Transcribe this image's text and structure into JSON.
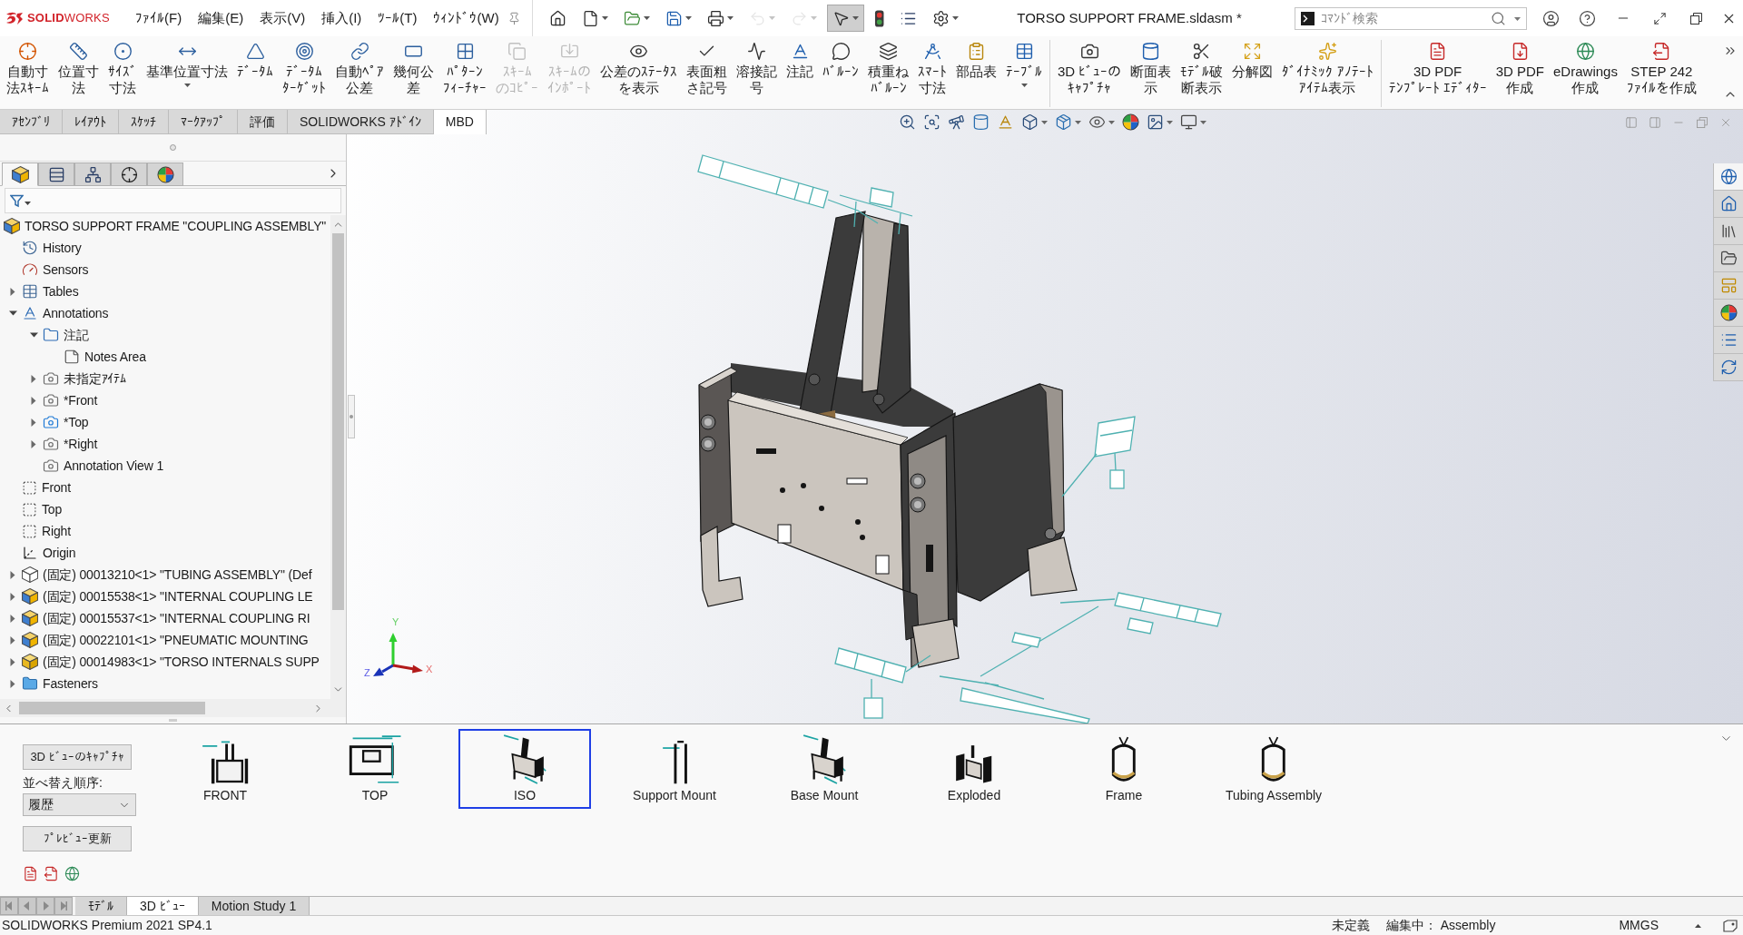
{
  "app": {
    "logo": "**SOLID**WORKS"
  },
  "menu": [
    "ﾌｧｲﾙ(F)",
    "編集(E)",
    "表示(V)",
    "挿入(I)",
    "ﾂｰﾙ(T)",
    "ｳｨﾝﾄﾞｳ(W)"
  ],
  "quick_access": [
    {
      "dropdown": false,
      "disabled": false,
      "pressed": false
    },
    {
      "dropdown": true,
      "disabled": false,
      "pressed": false
    },
    {
      "dropdown": true,
      "disabled": false,
      "pressed": false
    },
    {
      "dropdown": true,
      "disabled": false,
      "pressed": false
    },
    {
      "dropdown": true,
      "disabled": false,
      "pressed": false
    },
    {
      "dropdown": true,
      "disabled": true,
      "pressed": false
    },
    {
      "dropdown": true,
      "disabled": true,
      "pressed": false
    },
    {
      "dropdown": true,
      "disabled": false,
      "pressed": true
    },
    {
      "dropdown": false,
      "disabled": false,
      "pressed": false
    },
    {
      "dropdown": false,
      "disabled": false,
      "pressed": false
    },
    {
      "dropdown": true,
      "disabled": false,
      "pressed": false
    }
  ],
  "window": {
    "title": "TORSO SUPPORT FRAME.sldasm *"
  },
  "search": {
    "placeholder": "ｺﾏﾝﾄﾞ検索"
  },
  "ribbon_groups": [
    {
      "items": [
        {
          "lines": [
            "自動寸",
            "法ｽｷｰﾑ"
          ],
          "disabled": false,
          "dropdown": false
        },
        {
          "lines": [
            "位置寸",
            "法"
          ],
          "disabled": false,
          "dropdown": false
        },
        {
          "lines": [
            "ｻｲｽﾞ",
            "寸法"
          ],
          "disabled": false,
          "dropdown": false
        },
        {
          "lines": [
            "基準位置寸法"
          ],
          "disabled": false,
          "dropdown": true
        },
        {
          "lines": [
            "ﾃﾞｰﾀﾑ"
          ],
          "disabled": false,
          "dropdown": false
        },
        {
          "lines": [
            "ﾃﾞｰﾀﾑ",
            "ﾀｰｹﾞｯﾄ"
          ],
          "disabled": false,
          "dropdown": false
        },
        {
          "lines": [
            "自動ﾍﾟｱ",
            "公差"
          ],
          "disabled": false,
          "dropdown": false
        },
        {
          "lines": [
            "幾何公",
            "差"
          ],
          "disabled": false,
          "dropdown": false
        },
        {
          "lines": [
            "ﾊﾟﾀｰﾝ",
            "ﾌｨｰﾁｬｰ"
          ],
          "disabled": false,
          "dropdown": false
        },
        {
          "lines": [
            "ｽｷｰﾑ",
            "のｺﾋﾟｰ"
          ],
          "disabled": true,
          "dropdown": false
        },
        {
          "lines": [
            "ｽｷｰﾑの",
            "ｲﾝﾎﾟｰﾄ"
          ],
          "disabled": true,
          "dropdown": false
        },
        {
          "lines": [
            "公差のｽﾃｰﾀｽ",
            "を表示"
          ],
          "disabled": false,
          "dropdown": false
        },
        {
          "lines": [
            "表面粗",
            "さ記号"
          ],
          "disabled": false,
          "dropdown": false
        },
        {
          "lines": [
            "溶接記",
            "号"
          ],
          "disabled": false,
          "dropdown": false
        },
        {
          "lines": [
            "注記"
          ],
          "disabled": false,
          "dropdown": false
        },
        {
          "lines": [
            "ﾊﾞﾙｰﾝ"
          ],
          "disabled": false,
          "dropdown": false
        },
        {
          "lines": [
            "積重ね",
            "ﾊﾞﾙｰﾝ"
          ],
          "disabled": false,
          "dropdown": false
        },
        {
          "lines": [
            "ｽﾏｰﾄ",
            "寸法"
          ],
          "disabled": false,
          "dropdown": false
        },
        {
          "lines": [
            "部品表"
          ],
          "disabled": false,
          "dropdown": false
        },
        {
          "lines": [
            "ﾃｰﾌﾞﾙ"
          ],
          "disabled": false,
          "dropdown": true
        }
      ]
    },
    {
      "items": [
        {
          "lines": [
            "3D ﾋﾞｭｰの",
            "ｷｬﾌﾟﾁｬ"
          ],
          "disabled": false,
          "dropdown": false
        },
        {
          "lines": [
            "断面表",
            "示"
          ],
          "disabled": false,
          "dropdown": false
        },
        {
          "lines": [
            "ﾓﾃﾞﾙ破",
            "断表示"
          ],
          "disabled": false,
          "dropdown": false
        },
        {
          "lines": [
            "分解図"
          ],
          "disabled": false,
          "dropdown": false
        },
        {
          "lines": [
            "ﾀﾞｲﾅﾐｯｸ ｱﾉﾃｰﾄ",
            "ｱｲﾃﾑ表示"
          ],
          "disabled": false,
          "dropdown": false
        }
      ]
    },
    {
      "items": [
        {
          "lines": [
            "3D PDF",
            "ﾃﾝﾌﾟﾚｰﾄ ｴﾃﾞｨﾀｰ"
          ],
          "disabled": false,
          "dropdown": false
        },
        {
          "lines": [
            "3D PDF",
            "作成"
          ],
          "disabled": false,
          "dropdown": false
        },
        {
          "lines": [
            "eDrawings",
            "作成"
          ],
          "disabled": false,
          "dropdown": false
        },
        {
          "lines": [
            "STEP 242",
            "ﾌｧｲﾙを作成"
          ],
          "disabled": false,
          "dropdown": false
        }
      ]
    }
  ],
  "command_tabs": [
    {
      "label": "ｱｾﾝﾌﾞﾘ",
      "selected": false
    },
    {
      "label": "ﾚｲｱｳﾄ",
      "selected": false
    },
    {
      "label": "ｽｹｯﾁ",
      "selected": false
    },
    {
      "label": "ﾏｰｸｱｯﾌﾟ",
      "selected": false
    },
    {
      "label": "評価",
      "selected": false
    },
    {
      "label": "SOLIDWORKS ｱﾄﾞｲﾝ",
      "selected": false
    },
    {
      "label": "MBD",
      "selected": true
    }
  ],
  "view_toolbar": [
    {
      "dropdown": false
    },
    {
      "dropdown": false
    },
    {
      "dropdown": false
    },
    {
      "dropdown": false
    },
    {
      "dropdown": false
    },
    {
      "dropdown": true
    },
    {
      "dropdown": true
    },
    {
      "dropdown": true
    },
    {
      "dropdown": false
    },
    {
      "dropdown": true
    },
    {
      "dropdown": true
    }
  ],
  "feature_manager": {
    "tabs": [
      {
        "selected": true
      },
      {
        "selected": false
      },
      {
        "selected": false
      },
      {
        "selected": false
      },
      {
        "selected": false
      }
    ],
    "tree": {
      "label": "TORSO SUPPORT FRAME \"COUPLING ASSEMBLY\"",
      "kind": "root",
      "children": [
        {
          "label": "History",
          "kind": "history"
        },
        {
          "label": "Sensors",
          "kind": "sensors"
        },
        {
          "label": "Tables",
          "kind": "tables",
          "expanded": false
        },
        {
          "label": "Annotations",
          "kind": "annotations",
          "expanded": true,
          "children": [
            {
              "label": "注記",
              "kind": "folder2d",
              "expanded": true,
              "children": [
                {
                  "label": "Notes Area",
                  "kind": "note"
                }
              ]
            },
            {
              "label": "未指定ｱｲﾃﾑ",
              "kind": "view",
              "expanded": false,
              "active": false
            },
            {
              "label": "*Front",
              "kind": "view",
              "expanded": false,
              "active": false
            },
            {
              "label": "*Top",
              "kind": "view",
              "expanded": false,
              "active": true
            },
            {
              "label": "*Right",
              "kind": "view",
              "expanded": false,
              "active": false
            },
            {
              "label": "Annotation View 1",
              "kind": "view",
              "active": false
            }
          ]
        },
        {
          "label": "Front",
          "kind": "plane"
        },
        {
          "label": "Top",
          "kind": "plane"
        },
        {
          "label": "Right",
          "kind": "plane"
        },
        {
          "label": "Origin",
          "kind": "origin"
        },
        {
          "label": "(固定) 00013210<1> \"TUBING ASSEMBLY\" (Def",
          "kind": "ghost",
          "expanded": false
        },
        {
          "label": "(固定) 00015538<1> \"INTERNAL COUPLING LE",
          "kind": "subassembly",
          "expanded": false
        },
        {
          "label": "(固定) 00015537<1> \"INTERNAL COUPLING RI",
          "kind": "subassembly",
          "expanded": false
        },
        {
          "label": "(固定) 00022101<1> \"PNEUMATIC MOUNTING",
          "kind": "subassembly",
          "expanded": false
        },
        {
          "label": "(固定) 00014983<1> \"TORSO INTERNALS SUPP",
          "kind": "part",
          "expanded": false
        },
        {
          "label": "Fasteners",
          "kind": "fasteners",
          "expanded": false
        }
      ]
    }
  },
  "task_pane": [
    {
      "selected": true
    },
    {
      "selected": false
    },
    {
      "selected": false
    },
    {
      "selected": false
    },
    {
      "selected": false
    },
    {
      "selected": false
    },
    {
      "selected": false
    },
    {
      "selected": false
    }
  ],
  "triad": [
    {
      "label": "Y"
    },
    {
      "label": "Z"
    },
    {
      "label": "X"
    }
  ],
  "views_panel": {
    "capture_button": "3D ﾋﾞｭｰのｷｬﾌﾟﾁｬ",
    "sort_label": "並べ替え順序:",
    "sort_value": "履歴",
    "refresh_button": "ﾌﾟﾚﾋﾞｭｰ更新",
    "views": [
      {
        "label": "FRONT",
        "selected": false
      },
      {
        "label": "TOP",
        "selected": false
      },
      {
        "label": "ISO",
        "selected": true
      },
      {
        "label": "Support Mount",
        "selected": false
      },
      {
        "label": "Base Mount",
        "selected": false
      },
      {
        "label": "Exploded",
        "selected": false
      },
      {
        "label": "Frame",
        "selected": false
      },
      {
        "label": "Tubing Assembly",
        "selected": false
      }
    ]
  },
  "bottom_tabs": [
    {
      "label": "ﾓﾃﾞﾙ",
      "selected": false
    },
    {
      "label": "3D ﾋﾞｭｰ",
      "selected": true
    },
    {
      "label": "Motion Study 1",
      "selected": false
    }
  ],
  "status_bar": {
    "product": "SOLIDWORKS Premium 2021 SP4.1",
    "definition": "未定義",
    "editing": "編集中： Assembly",
    "units": "MMGS"
  }
}
